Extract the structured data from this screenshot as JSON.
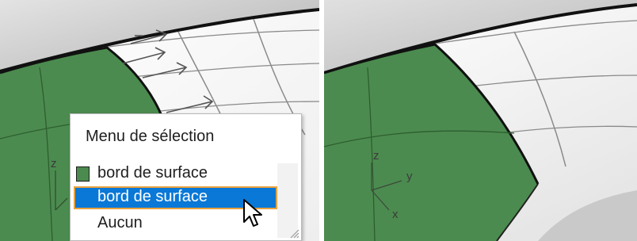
{
  "selection_menu": {
    "title": "Menu de sélection",
    "items": [
      {
        "label": "bord de surface",
        "icon": "green-surface-swatch-icon",
        "swatch_color": "#4c8b4f",
        "selected": false
      },
      {
        "label": "bord de surface",
        "selected": true
      },
      {
        "label": "Aucun",
        "selected": false
      }
    ]
  },
  "axis_labels": {
    "left": {
      "z": "z"
    },
    "right": {
      "z": "z",
      "y": "y",
      "x": "x"
    }
  },
  "colors": {
    "surface_green": "#4c8b4f",
    "selection_blue": "#0a78d6",
    "selection_border": "#e8a23e",
    "background_gray": "#a9a9a9"
  }
}
